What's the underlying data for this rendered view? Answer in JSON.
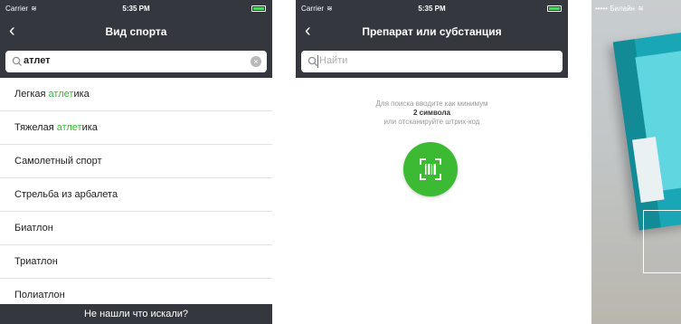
{
  "status_bar": {
    "carrier": "Carrier",
    "time": "5:35 PM",
    "carrier_3": "••••• Билайн"
  },
  "screen1": {
    "title": "Вид спорта",
    "search_value": "атлет",
    "results": [
      {
        "before": "Легкая ",
        "match": "атлет",
        "after": "ика"
      },
      {
        "before": "Тяжелая ",
        "match": "атлет",
        "after": "ика"
      },
      {
        "before": "Самолетный спорт",
        "match": "",
        "after": ""
      },
      {
        "before": "Стрельба из арбалета",
        "match": "",
        "after": ""
      },
      {
        "before": "Биатлон",
        "match": "",
        "after": ""
      },
      {
        "before": "Триатлон",
        "match": "",
        "after": ""
      },
      {
        "before": "Полиатлон",
        "match": "",
        "after": ""
      }
    ],
    "footer": "Не нашли что искали?"
  },
  "screen2": {
    "title": "Препарат или субстанция",
    "search_placeholder": "Найти",
    "hint_line1": "Для поиска вводите как минимум",
    "hint_line2": "2 символа",
    "hint_line3": "или отсканируйте штрих-код"
  },
  "colors": {
    "bar": "#34383e",
    "accent_green": "#3cba34",
    "highlight_green": "#3db83d"
  },
  "icons": {
    "back": "chevron-left-icon",
    "search": "search-icon",
    "clear": "clear-icon",
    "barcode": "barcode-scan-icon",
    "wifi": "wifi-icon"
  }
}
